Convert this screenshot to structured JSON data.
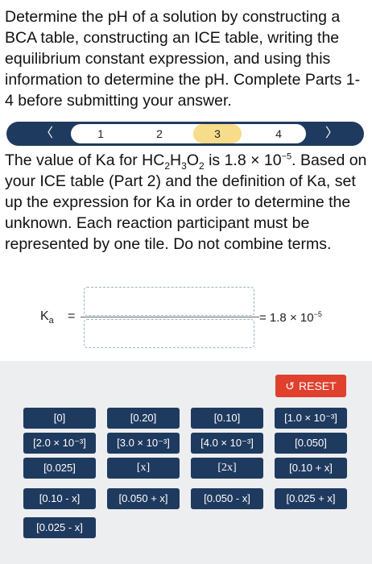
{
  "instructions": "Determine the pH of a solution by constructing a BCA table, constructing an ICE table, writing the equilibrium constant expression, and using this information to determine the pH. Complete Parts 1-4 before submitting your answer.",
  "stepper": {
    "prev_icon": "chevron-left-icon",
    "next_icon": "chevron-right-icon",
    "prev_glyph": "〈",
    "next_glyph": "〉",
    "steps": [
      "1",
      "2",
      "3",
      "4"
    ],
    "current_step": "3",
    "current_color": "#f7dc8a"
  },
  "question": {
    "text_1": "The value of Ka for HC",
    "sub_1": "2",
    "text_2": "H",
    "sub_2": "3",
    "text_3": "O",
    "sub_3": "2",
    "text_4": " is 1.8 × 10",
    "sup_1": "−5",
    "text_5": ". Based on your ICE table (Part 2) and the definition of Ka, set up the expression for Ka in order to determine the unknown. Each reaction participant must be represented by one tile. Do not combine terms."
  },
  "expression": {
    "ka_label": "K",
    "ka_sub": "a",
    "equals": "=",
    "rhs_prefix": "= 1.8 × 10",
    "rhs_exp": "−5"
  },
  "bank": {
    "reset_label": "RESET",
    "reset_icon": "undo-icon",
    "reset_color": "#e0402e",
    "tile_color": "#1f3a5f",
    "tiles": [
      "[0]",
      "[0.20]",
      "[0.10]",
      "[1.0 × 10⁻³]",
      "[2.0 × 10⁻³]",
      "[3.0 × 10⁻³]",
      "[4.0 × 10⁻³]",
      "[0.050]",
      "[0.025]",
      "[x]",
      "[2x]",
      "[0.10 + x]",
      "[0.10 - x]",
      "[0.050 + x]",
      "[0.050 - x]",
      "[0.025 + x]",
      "[0.025 - x]"
    ]
  }
}
